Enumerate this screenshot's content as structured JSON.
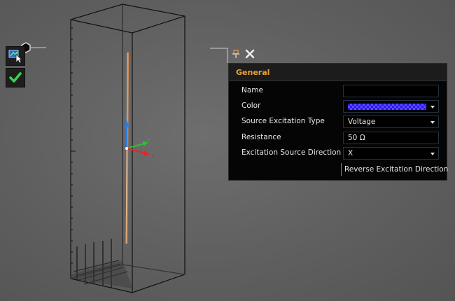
{
  "panel": {
    "section_title": "General",
    "fields": {
      "name": {
        "label": "Name",
        "value": ""
      },
      "color": {
        "label": "Color",
        "value_color": "#2a16e8"
      },
      "source_type": {
        "label": "Source Excitation Type",
        "value": "Voltage"
      },
      "resistance": {
        "label": "Resistance",
        "value": "50 Ω"
      },
      "direction": {
        "label": "Excitation Source Direction",
        "value": "X"
      }
    },
    "reverse_button": "Reverse Excitation Direction"
  },
  "axes": {
    "x": "X",
    "y": "Y",
    "z": "Z"
  },
  "icons": {
    "panel_pin": "pin-icon",
    "panel_close": "close-icon",
    "toolbar_select": "select-edit-icon",
    "toolbar_confirm": "checkmark-icon",
    "handle": "hexagon-handle-icon"
  },
  "colors": {
    "accent": "#e8a23a",
    "check": "#3ecf4e",
    "wire": "#c98a5a",
    "axis_x": "#e02828",
    "axis_y": "#2ec02e",
    "axis_z": "#2f7be0"
  }
}
